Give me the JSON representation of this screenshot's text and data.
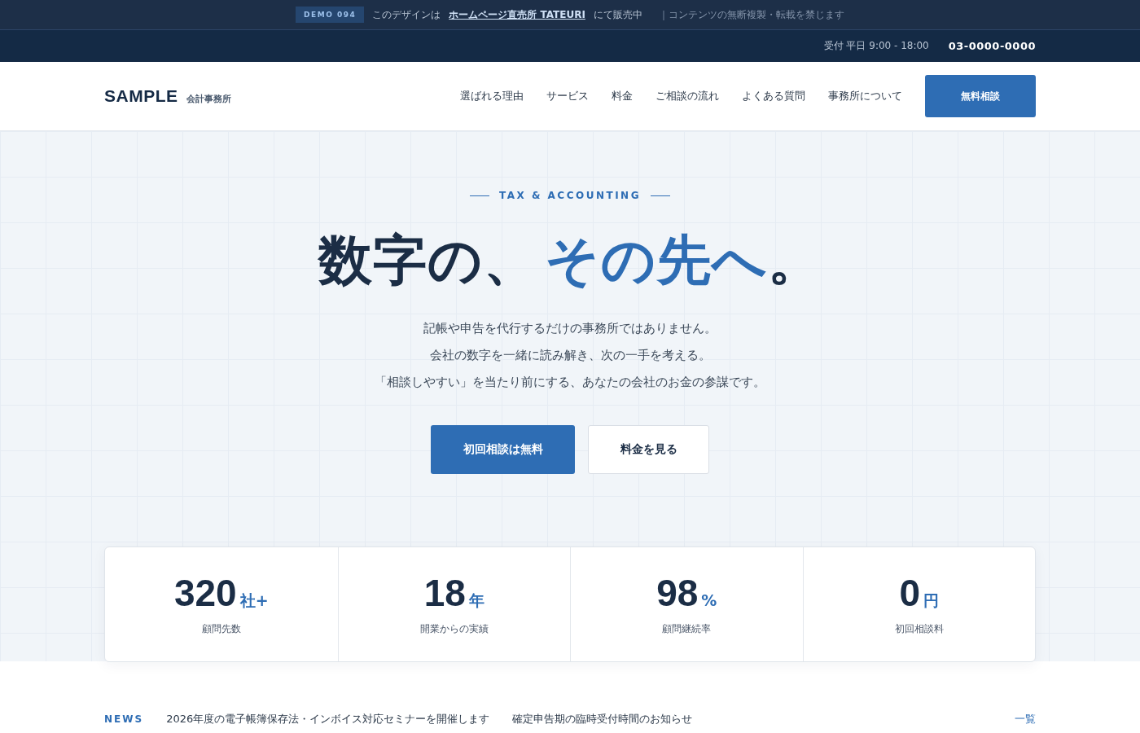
{
  "notice_bar": {
    "badge": "DEMO 094",
    "text_before": "このデザインは",
    "link": "ホームページ直売所 TATEURI",
    "text_after": "にて販売中",
    "note": "｜コンテンツの無断複製・転載を禁じます"
  },
  "info_bar": {
    "hours": "受付 平日 9:00 - 18:00",
    "phone": "03-0000-0000"
  },
  "header": {
    "logo": "SAMPLE",
    "logo_sub": "会計事務所",
    "nav": [
      "選ばれる理由",
      "サービス",
      "料金",
      "ご相談の流れ",
      "よくある質問",
      "事務所について"
    ],
    "cta": "無料相談"
  },
  "hero": {
    "eyebrow": "TAX & ACCOUNTING",
    "title_dark": "数字の、",
    "title_accent": "その先へ",
    "title_end": "。",
    "lines": [
      "記帳や申告を代行するだけの事務所ではありません。",
      "会社の数字を一緒に読み解き、次の一手を考える。",
      "「相談しやすい」を当たり前にする、あなたの会社のお金の参謀です。"
    ],
    "buttons": [
      {
        "label": "初回相談は無料",
        "kind": "primary"
      },
      {
        "label": "料金を見る",
        "kind": "secondary"
      }
    ]
  },
  "stats": [
    {
      "value": "320",
      "unit": "社+",
      "label": "顧問先数"
    },
    {
      "value": "18",
      "unit": "年",
      "label": "開業からの実績"
    },
    {
      "value": "98",
      "unit": "%",
      "label": "顧問継続率"
    },
    {
      "value": "0",
      "unit": "円",
      "label": "初回相談料"
    }
  ],
  "news": {
    "heading": "NEWS",
    "items": [
      "2026年度の電子帳簿保存法・インボイス対応セミナーを開催します",
      "確定申告期の臨時受付時間のお知らせ"
    ],
    "more": "一覧"
  }
}
